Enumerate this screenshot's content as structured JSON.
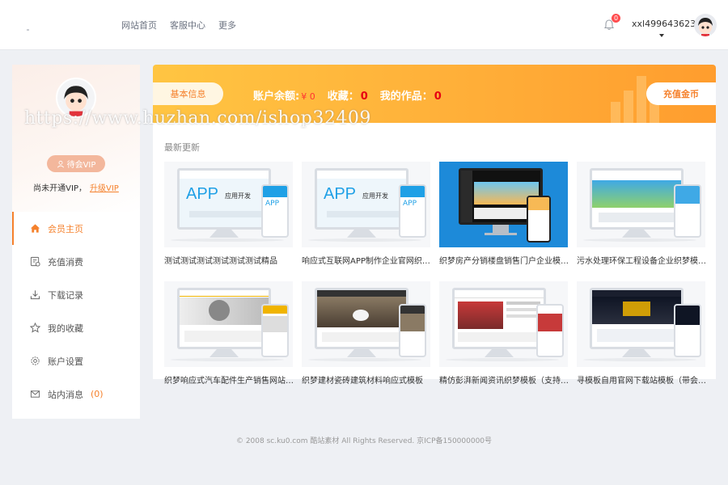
{
  "header": {
    "nav": [
      "网站首页",
      "客服中心",
      "更多"
    ],
    "notification_count": "0",
    "username": "xxl499643623"
  },
  "sidebar": {
    "vip_button": "待会VIP",
    "vip_status": "尚未开通VIP，",
    "upgrade_link": "升级VIP",
    "menu": [
      {
        "label": "会员主页",
        "icon": "home-icon"
      },
      {
        "label": "充值消费",
        "icon": "recharge-icon"
      },
      {
        "label": "下载记录",
        "icon": "download-icon"
      },
      {
        "label": "我的收藏",
        "icon": "star-icon"
      },
      {
        "label": "账户设置",
        "icon": "gear-icon"
      },
      {
        "label": "站内消息",
        "icon": "mail-icon",
        "count": "(0)"
      }
    ]
  },
  "banner": {
    "tab": "基本信息",
    "balance_label": "账户余额:",
    "balance_value": "¥ 0",
    "favorites_label": "收藏：",
    "favorites_value": "0",
    "works_label": "我的作品：",
    "works_value": "0",
    "recharge_button": "充值金币"
  },
  "watermark": "https://www.huzhan.com/ishop32409",
  "content": {
    "section_title": "最新更新",
    "cards": [
      {
        "title": "测试测试测试测试测试测试精品",
        "thumb": "app-template"
      },
      {
        "title": "响应式互联网APP制作企业官网织梦模板",
        "thumb": "app-template"
      },
      {
        "title": "织梦房产分销楼盘销售门户企业模板(带…",
        "thumb": "realestate-template"
      },
      {
        "title": "污水处理环保工程设备企业织梦模板(带…",
        "thumb": "environment-template"
      },
      {
        "title": "织梦响应式汽车配件生产销售网站模板",
        "thumb": "auto-parts-template"
      },
      {
        "title": "织梦建材瓷砖建筑材料响应式模板",
        "thumb": "building-materials-template"
      },
      {
        "title": "精仿彭湃新闻资讯织梦模板（支持移动…",
        "thumb": "news-template"
      },
      {
        "title": "寻模板自用官网下载站模板（带会员中…",
        "thumb": "download-site-template"
      }
    ]
  },
  "app_thumb_text": {
    "big": "APP",
    "sub": "应用开发",
    "phone": "APP"
  },
  "footer": "© 2008 sc.ku0.com 酷站素材 All Rights Reserved. 京ICP备150000000号"
}
